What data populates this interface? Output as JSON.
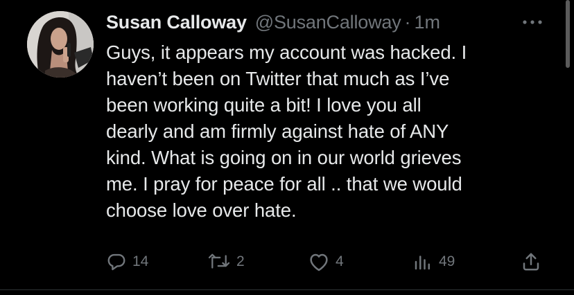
{
  "tweet": {
    "author": {
      "display_name": "Susan Calloway",
      "handle": "@SusanCalloway",
      "separator": "·",
      "timestamp": "1m",
      "avatar_icon": "profile-photo"
    },
    "text": "Guys, it appears my account was hacked. I\nhaven’t been on Twitter that much as I’ve\nbeen working quite a bit! I love you all\ndearly and am firmly against hate of ANY\nkind. What is going on in our world grieves\nme. I pray for peace for all .. that we would\nchoose love over hate.",
    "actions": {
      "reply": {
        "icon": "reply-icon",
        "count": "14"
      },
      "retweet": {
        "icon": "retweet-icon",
        "count": "2"
      },
      "like": {
        "icon": "heart-icon",
        "count": "4"
      },
      "views": {
        "icon": "views-icon",
        "count": "49"
      },
      "share": {
        "icon": "share-icon"
      }
    },
    "more_icon": "more-options-icon"
  },
  "colors": {
    "background": "#000000",
    "primary_text": "#e7e9ea",
    "secondary_text": "#71767b",
    "divider": "#2f3336"
  }
}
